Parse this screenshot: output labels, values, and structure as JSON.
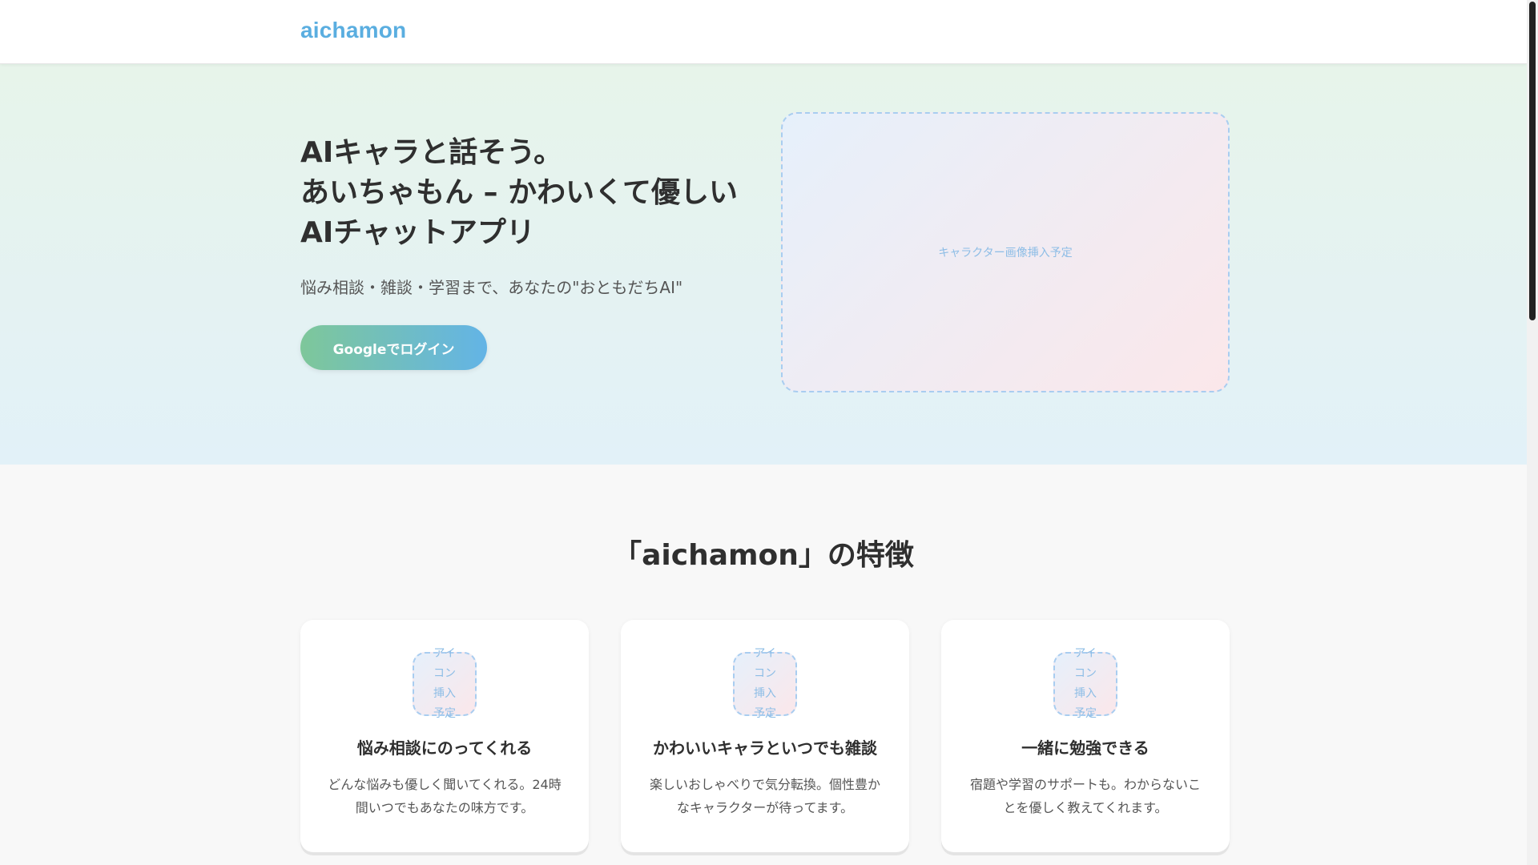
{
  "header": {
    "logo": "aichamon"
  },
  "hero": {
    "title_lines": [
      "AIキャラと話そう。",
      "あいちゃもん – かわいくて優しい",
      "AIチャットアプリ"
    ],
    "subtitle": "悩み相談・雑談・学習まで、あなたの\"おともだちAI\"",
    "login_button": "Googleでログイン",
    "image_placeholder": "キャラクター画像挿入予定"
  },
  "features": {
    "title": "「aichamon」の特徴",
    "cards": [
      {
        "icon_placeholder": "アイコン挿入予定",
        "title": "悩み相談にのってくれる",
        "description": "どんな悩みも優しく聞いてくれる。24時間いつでもあなたの味方です。"
      },
      {
        "icon_placeholder": "アイコン挿入予定",
        "title": "かわいいキャラといつでも雑談",
        "description": "楽しいおしゃべりで気分転換。個性豊かなキャラクターが待ってます。"
      },
      {
        "icon_placeholder": "アイコン挿入予定",
        "title": "一緒に勉強できる",
        "description": "宿題や学習のサポートも。わからないことを優しく教えてくれます。"
      }
    ]
  },
  "colors": {
    "brand": "#5aaee0",
    "button_gradient_start": "#7ec79a",
    "button_gradient_end": "#63b4e6",
    "placeholder_border": "#a9cdf0"
  }
}
